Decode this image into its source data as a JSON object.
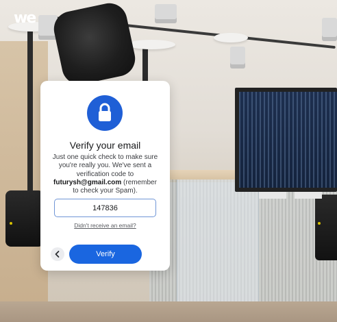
{
  "brand": {
    "logo_text": "we"
  },
  "verify_dialog": {
    "title": "Verify your email",
    "message_before_email": "Just one quick check to make sure you're really you. We've sent a verification code to",
    "email": "futurysh@gmail.com",
    "message_after_email": "(remember to check your Spam).",
    "code_value": "147836",
    "resend_link": "Didn't receive an email?",
    "verify_button": "Verify",
    "back_icon": "chevron-left-icon",
    "lock_icon": "lock-icon",
    "accent_color": "#1a66e0"
  }
}
